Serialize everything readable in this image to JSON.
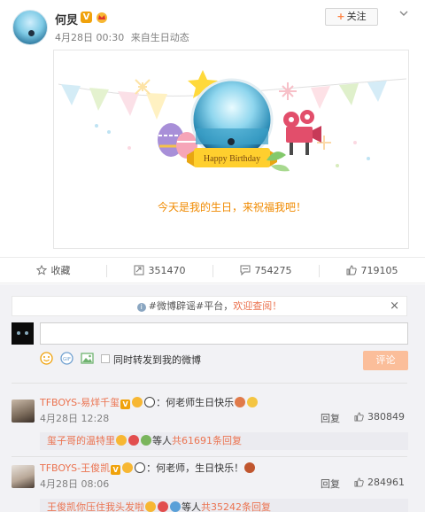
{
  "post": {
    "author": "何炅",
    "time": "4月28日 00:30",
    "source_prefix": "来自",
    "source": "生日动态",
    "follow_label": "关注",
    "follow_plus": "+"
  },
  "card": {
    "banner_text": "Happy Birthday",
    "message": "今天是我的生日，来祝福我吧！"
  },
  "actions": {
    "favorite_label": "收藏",
    "repost_count": "351470",
    "comment_count": "754275",
    "like_count": "719105"
  },
  "notice": {
    "text_main": "#微博辟谣#平台，",
    "text_highlight": "欢迎查阅！",
    "close": "×"
  },
  "composer": {
    "sync_label": "同时转发到我的微博",
    "submit_label": "评论",
    "input_value": ""
  },
  "comments": [
    {
      "user": "TFBOYS-易烊千玺",
      "text": "：何老师生日快乐",
      "time": "4月28日 12:28",
      "reply_label": "回复",
      "likes": "380849",
      "sub_user": "玺子哥的温特里",
      "sub_mid": "等人",
      "sub_count": "共61691条回复"
    },
    {
      "user": "TFBOYS-王俊凯",
      "text": "：何老师，生日快乐！",
      "time": "4月28日 08:06",
      "reply_label": "回复",
      "likes": "284961",
      "sub_user": "王俊凯你压住我头发啦",
      "sub_mid": "等人",
      "sub_count": "共35242条回复"
    }
  ],
  "colors": {
    "accent": "#eb7350",
    "card_text": "#f08a00",
    "vip": "#f0a20b",
    "submit": "#fbbe9a"
  }
}
